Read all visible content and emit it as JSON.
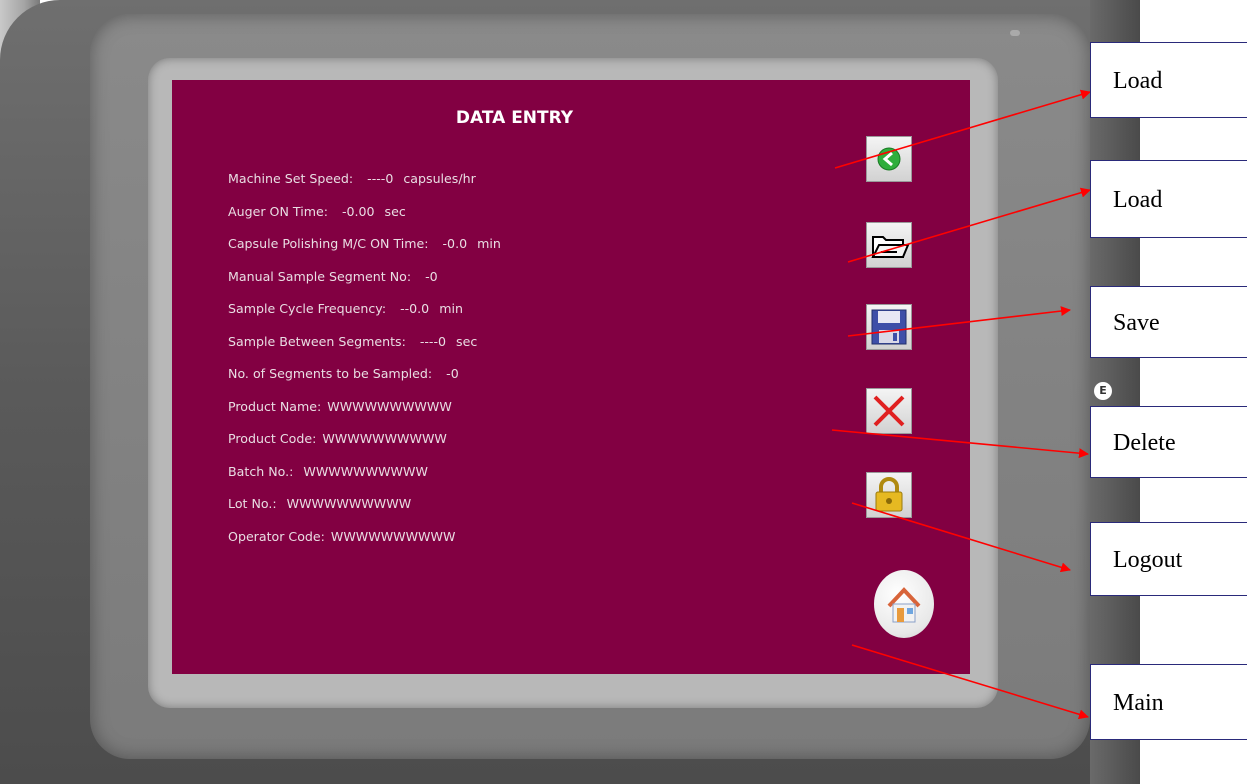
{
  "screen": {
    "title": "DATA ENTRY",
    "fields": [
      {
        "label": "Machine Set Speed:",
        "value": "----0",
        "unit": "capsules/hr"
      },
      {
        "label": "Auger ON Time:",
        "value": "-0.00",
        "unit": "sec"
      },
      {
        "label": "Capsule Polishing M/C ON Time:",
        "value": "-0.0",
        "unit": "min"
      },
      {
        "label": "Manual Sample Segment No:",
        "value": "-0",
        "unit": ""
      },
      {
        "label": "Sample Cycle Frequency:",
        "value": "--0.0",
        "unit": "min"
      },
      {
        "label": "Sample Between Segments:",
        "value": "----0",
        "unit": "sec"
      },
      {
        "label": "No. of Segments to be Sampled:",
        "value": "-0",
        "unit": ""
      },
      {
        "label": "Product Name:",
        "value": "WWWWWWWWWW",
        "unit": ""
      },
      {
        "label": "Product Code:",
        "value": "WWWWWWWWWW",
        "unit": ""
      },
      {
        "label": "Batch No.:",
        "value": "WWWWWWWWWW",
        "unit": ""
      },
      {
        "label": "Lot No.:",
        "value": "WWWWWWWWWW",
        "unit": ""
      },
      {
        "label": "Operator Code:",
        "value": "WWWWWWWWWW",
        "unit": ""
      }
    ],
    "buttons": [
      {
        "icon": "green-back-arrow-icon"
      },
      {
        "icon": "open-folder-icon"
      },
      {
        "icon": "floppy-disk-icon"
      },
      {
        "icon": "red-x-icon"
      },
      {
        "icon": "padlock-icon"
      },
      {
        "icon": "home-icon"
      }
    ]
  },
  "callouts": [
    "Load",
    "Load",
    "Save",
    "Delete",
    "Logout",
    "Main"
  ],
  "colors": {
    "screen_background": "#820042",
    "arrow": "#ff0000",
    "callout_border": "#2a2a7a"
  }
}
